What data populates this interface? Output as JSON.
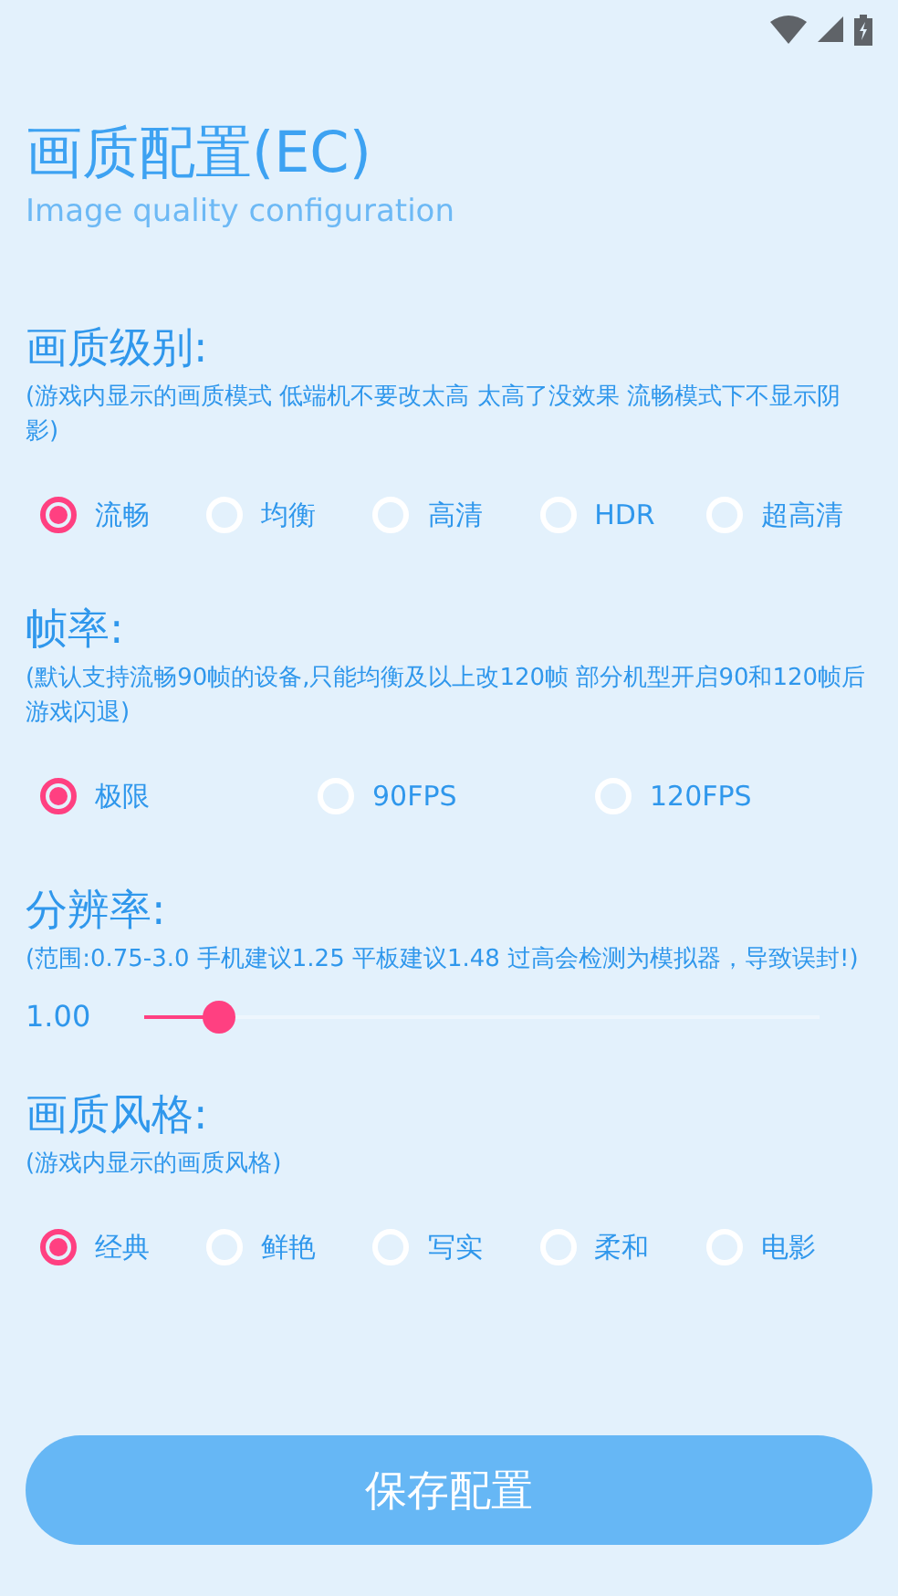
{
  "title": "画质配置(EC)",
  "subtitle": "Image quality configuration",
  "sections": [
    {
      "kind": "radio",
      "heading": "画质级别:",
      "note": "(游戏内显示的画质模式 低端机不要改太高 太高了没效果 流畅模式下不显示阴影)",
      "options": [
        {
          "label": "流畅",
          "selected": true
        },
        {
          "label": "均衡",
          "selected": false
        },
        {
          "label": "高清",
          "selected": false
        },
        {
          "label": "HDR",
          "selected": false
        },
        {
          "label": "超高清",
          "selected": false
        }
      ]
    },
    {
      "kind": "radio",
      "heading": "帧率:",
      "note": "(默认支持流畅90帧的设备,只能均衡及以上改120帧  部分机型开启90和120帧后游戏闪退)",
      "options": [
        {
          "label": "极限",
          "selected": true
        },
        {
          "label": "90FPS",
          "selected": false
        },
        {
          "label": "120FPS",
          "selected": false
        }
      ]
    },
    {
      "kind": "slider",
      "heading": "分辨率:",
      "note": "(范围:0.75-3.0  手机建议1.25 平板建议1.48  过高会检测为模拟器，导致误封!)",
      "reading": "1.00",
      "level": 0.11
    },
    {
      "kind": "radio",
      "heading": "画质风格:",
      "note": "(游戏内显示的画质风格)",
      "options": [
        {
          "label": "经典",
          "selected": true
        },
        {
          "label": "鲜艳",
          "selected": false
        },
        {
          "label": "写实",
          "selected": false
        },
        {
          "label": "柔和",
          "selected": false
        },
        {
          "label": "电影",
          "selected": false
        }
      ]
    }
  ],
  "save_button": "保存配置"
}
